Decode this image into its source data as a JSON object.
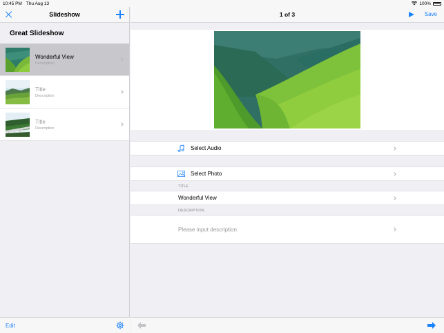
{
  "status_bar": {
    "time": "10:45 PM",
    "date": "Thu Aug 13",
    "battery": "100%"
  },
  "sidebar": {
    "title": "Slideshow",
    "close_icon": "close-icon",
    "add_icon": "plus-icon",
    "header": "Great Slideshow",
    "items": [
      {
        "title": "Wonderful View",
        "description": "Description",
        "selected": true
      },
      {
        "title": "Title",
        "description": "Description",
        "selected": false
      },
      {
        "title": "Title",
        "description": "Description",
        "selected": false
      }
    ],
    "toolbar": {
      "edit_label": "Edit",
      "settings_icon": "gear-icon"
    }
  },
  "detail": {
    "page_indicator": "1 of 3",
    "play_icon": "play-icon",
    "save_label": "Save",
    "select_audio_label": "Select Audio",
    "select_photo_label": "Select Photo",
    "title_section_label": "TITLE",
    "title_value": "Wonderful View",
    "description_section_label": "DESCRIPTION",
    "description_placeholder": "Please input description",
    "toolbar": {
      "prev_icon": "arrow-left-icon",
      "next_icon": "arrow-right-icon"
    }
  },
  "colors": {
    "accent": "#1a82fb",
    "selected_row": "#c7c7cc",
    "background": "#efeff4"
  }
}
